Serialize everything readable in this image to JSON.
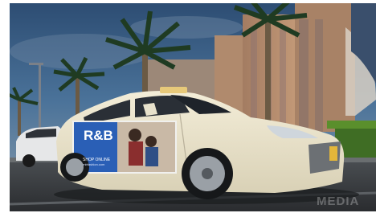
{
  "ad": {
    "brand": "R&B",
    "tagline": "SHOP ONLINE",
    "subline": "rnbfashion.com"
  },
  "watermark": "MEDIA",
  "colors": {
    "sky": "#3f6a93",
    "taxi": "#eee7cf",
    "ad_blue": "#2a5fb6",
    "hotel": "#b98d6e",
    "road": "#3a3d40",
    "grass": "#5a8f2c"
  }
}
